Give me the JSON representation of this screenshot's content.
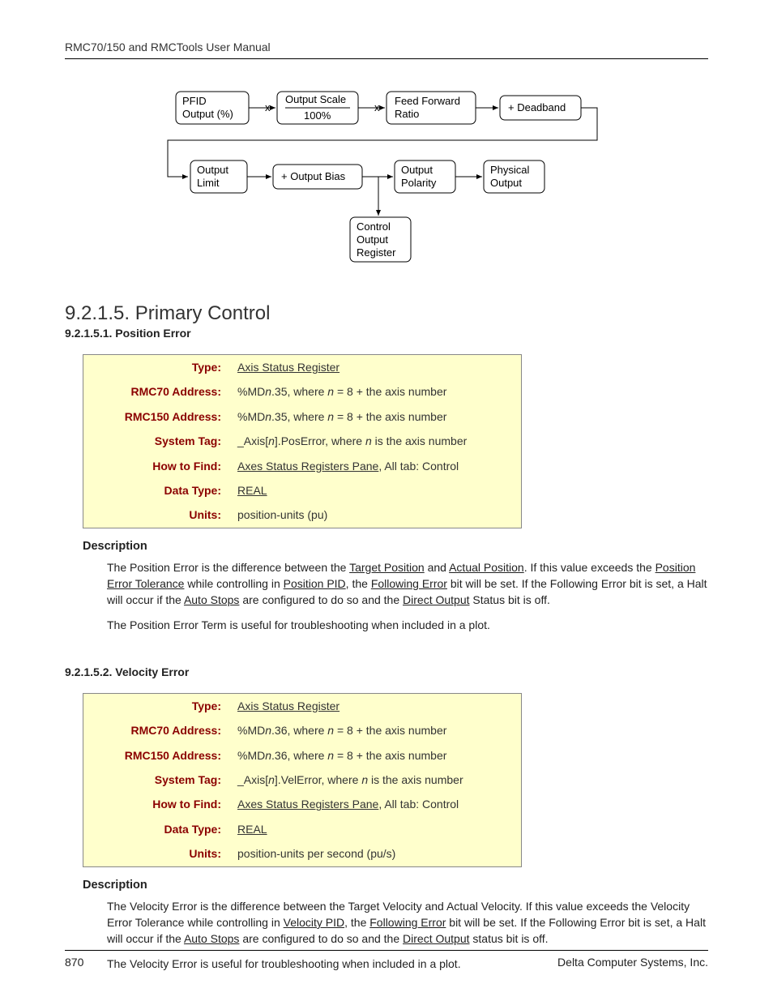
{
  "header": {
    "title": "RMC70/150 and RMCTools User Manual"
  },
  "diagram": {
    "row1": {
      "b1": {
        "l1": "PFID",
        "l2": "Output (%)"
      },
      "b2": {
        "l1": "Output Scale",
        "l2": "100%",
        "prefix": "x"
      },
      "b3": {
        "l1": "Feed Forward",
        "l2": "Ratio",
        "prefix": "x"
      },
      "b4": {
        "l1": "+ Deadband"
      }
    },
    "row2": {
      "b1": {
        "l1": "Output",
        "l2": "Limit"
      },
      "b2": {
        "l1": "+ Output Bias"
      },
      "b3": {
        "l1": "Output",
        "l2": "Polarity"
      },
      "b4": {
        "l1": "Physical",
        "l2": "Output"
      }
    },
    "row3": {
      "b1": {
        "l1": "Control",
        "l2": "Output",
        "l3": "Register"
      }
    }
  },
  "section": {
    "title": "9.2.1.5. Primary Control"
  },
  "posErr": {
    "heading": "9.2.1.5.1. Position Error",
    "rows": {
      "type_label": "Type:",
      "type_value": "Axis Status Register",
      "rmc70_label": "RMC70 Address:",
      "rmc70_value_pre": "%MD",
      "rmc70_value_var": "n",
      "rmc70_value_mid": ".35, where ",
      "rmc70_value_var2": "n",
      "rmc70_value_post": " = 8 + the axis number",
      "rmc150_label": "RMC150 Address:",
      "rmc150_value_pre": "%MD",
      "rmc150_value_var": "n",
      "rmc150_value_mid": ".35, where ",
      "rmc150_value_var2": "n",
      "rmc150_value_post": " = 8 + the axis number",
      "systag_label": "System Tag:",
      "systag_value_pre": "_Axis[",
      "systag_value_var": "n",
      "systag_value_mid": "].PosError, where ",
      "systag_value_var2": "n",
      "systag_value_post": " is the axis number",
      "howfind_label": "How to Find:",
      "howfind_link": "Axes Status Registers Pane",
      "howfind_post": ", All tab: Control",
      "datatype_label": "Data Type:",
      "datatype_value": "REAL",
      "units_label": "Units:",
      "units_value": "position-units (pu)"
    },
    "desc_head": "Description",
    "desc1": {
      "t0": "The Position Error is the difference between the ",
      "u1": "Target Position",
      "t1": " and ",
      "u2": "Actual Position",
      "t2": ". If this value exceeds the ",
      "u3": "Position Error Tolerance",
      "t3": " while controlling in ",
      "u4": "Position PID",
      "t4": ", the ",
      "u5": "Following Error",
      "t5": " bit will be set. If the Following Error bit is set, a Halt will occur if the ",
      "u6": "Auto Stops",
      "t6": " are configured to do so and the ",
      "u7": "Direct Output",
      "t7": " Status bit is off."
    },
    "desc2": "The Position Error Term is useful for troubleshooting when included in a plot."
  },
  "velErr": {
    "heading": "9.2.1.5.2. Velocity Error",
    "rows": {
      "type_label": "Type:",
      "type_value": "Axis Status Register",
      "rmc70_label": "RMC70 Address:",
      "rmc70_value_pre": "%MD",
      "rmc70_value_var": "n",
      "rmc70_value_mid": ".36, where ",
      "rmc70_value_var2": "n",
      "rmc70_value_post": " = 8 + the axis number",
      "rmc150_label": "RMC150 Address:",
      "rmc150_value_pre": "%MD",
      "rmc150_value_var": "n",
      "rmc150_value_mid": ".36, where ",
      "rmc150_value_var2": "n",
      "rmc150_value_post": " = 8 + the axis number",
      "systag_label": "System Tag:",
      "systag_value_pre": "_Axis[",
      "systag_value_var": "n",
      "systag_value_mid": "].VelError, where ",
      "systag_value_var2": "n",
      "systag_value_post": " is the axis number",
      "howfind_label": "How to Find:",
      "howfind_link": "Axes Status Registers Pane",
      "howfind_post": ", All tab: Control",
      "datatype_label": "Data Type:",
      "datatype_value": "REAL",
      "units_label": "Units:",
      "units_value": "position-units per second (pu/s)"
    },
    "desc_head": "Description",
    "desc1": {
      "t0": "The Velocity Error is the difference between the Target Velocity and Actual Velocity. If this value exceeds the Velocity Error Tolerance while controlling in ",
      "u1": "Velocity PID",
      "t1": ", the ",
      "u2": "Following Error",
      "t2": " bit will be set. If the Following Error bit is set, a Halt will occur if the ",
      "u3": "Auto Stops",
      "t3": " are configured to do so and the ",
      "u4": "Direct Output",
      "t4": " status bit is off."
    },
    "desc2": "The Velocity Error is useful for troubleshooting when included in a plot."
  },
  "footer": {
    "page": "870",
    "company": "Delta Computer Systems, Inc."
  }
}
